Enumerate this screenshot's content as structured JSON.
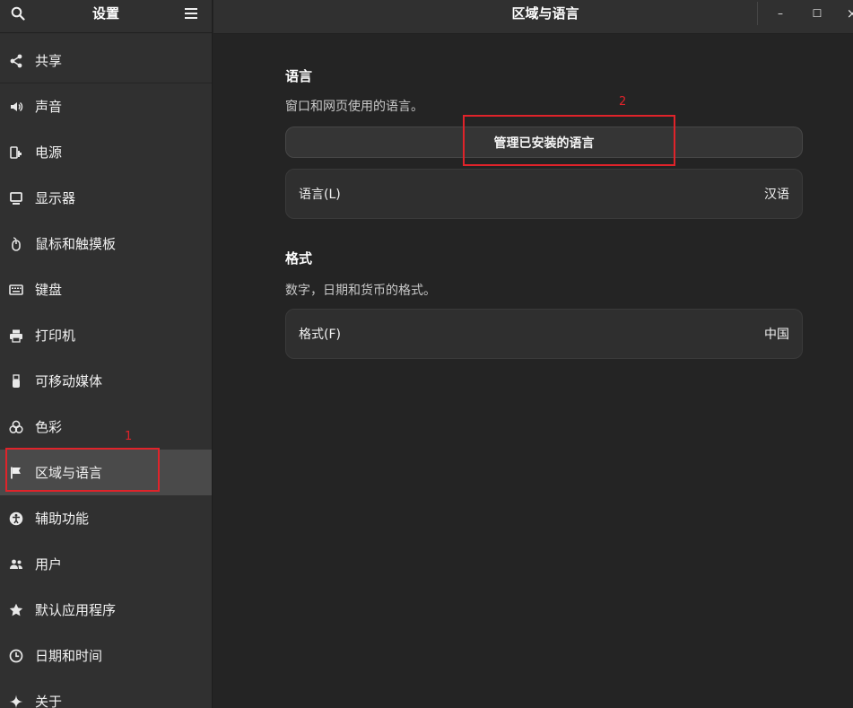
{
  "sidebar": {
    "title": "设置",
    "items": [
      {
        "label": "共享",
        "icon": "share-icon"
      },
      {
        "label": "声音",
        "icon": "speaker-icon"
      },
      {
        "label": "电源",
        "icon": "power-icon"
      },
      {
        "label": "显示器",
        "icon": "display-icon"
      },
      {
        "label": "鼠标和触摸板",
        "icon": "mouse-icon"
      },
      {
        "label": "键盘",
        "icon": "keyboard-icon"
      },
      {
        "label": "打印机",
        "icon": "printer-icon"
      },
      {
        "label": "可移动媒体",
        "icon": "usb-icon"
      },
      {
        "label": "色彩",
        "icon": "color-icon"
      },
      {
        "label": "区域与语言",
        "icon": "flag-icon",
        "active": true
      },
      {
        "label": "辅助功能",
        "icon": "accessibility-icon"
      },
      {
        "label": "用户",
        "icon": "users-icon"
      },
      {
        "label": "默认应用程序",
        "icon": "star-icon"
      },
      {
        "label": "日期和时间",
        "icon": "clock-icon"
      },
      {
        "label": "关于",
        "icon": "sparkle-icon"
      }
    ]
  },
  "header": {
    "title": "区域与语言",
    "minimize": "–",
    "maximize": "☐",
    "close": "×"
  },
  "language": {
    "title": "语言",
    "description": "窗口和网页使用的语言。",
    "manage_button": "管理已安装的语言",
    "row_label": "语言(L)",
    "row_value": "汉语"
  },
  "formats": {
    "title": "格式",
    "description": "数字，日期和货币的格式。",
    "row_label": "格式(F)",
    "row_value": "中国"
  },
  "annotations": [
    "1",
    "2"
  ],
  "colors": {
    "annotation": "#e0232a",
    "active_item": "#4a4a4a"
  }
}
